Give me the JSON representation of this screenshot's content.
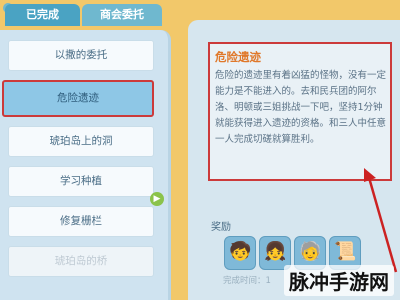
{
  "tabs": [
    {
      "label": "已完成"
    },
    {
      "label": "商会委托"
    }
  ],
  "quest_list": [
    {
      "label": "以撒的委托",
      "state": "normal"
    },
    {
      "label": "危险遗迹",
      "state": "selected"
    },
    {
      "label": "琥珀岛上的洞",
      "state": "normal"
    },
    {
      "label": "学习种植",
      "state": "normal"
    },
    {
      "label": "修复栅栏",
      "state": "normal"
    },
    {
      "label": "琥珀岛的桥",
      "state": "faded"
    }
  ],
  "detail": {
    "title": "危险遗迹",
    "description": "危险的遗迹里有着凶猛的怪物，没有一定能力是不能进入的。去和民兵团的阿尔洛、明顿或三姐挑战一下吧，坚持1分钟就能获得进入遗迹的资格。和三人中任意一人完成切磋就算胜利。"
  },
  "reward_label": "奖励",
  "rewards": [
    {
      "icon": "boy-portrait-icon"
    },
    {
      "icon": "girl-portrait-icon"
    },
    {
      "icon": "elder-portrait-icon"
    },
    {
      "icon": "scroll-item-icon"
    }
  ],
  "completion_time": "完成时间：1",
  "watermark": "脉冲手游网",
  "colors": {
    "highlight": "#cc3a3a",
    "title": "#e0782a",
    "panel": "#d6e6ef"
  }
}
